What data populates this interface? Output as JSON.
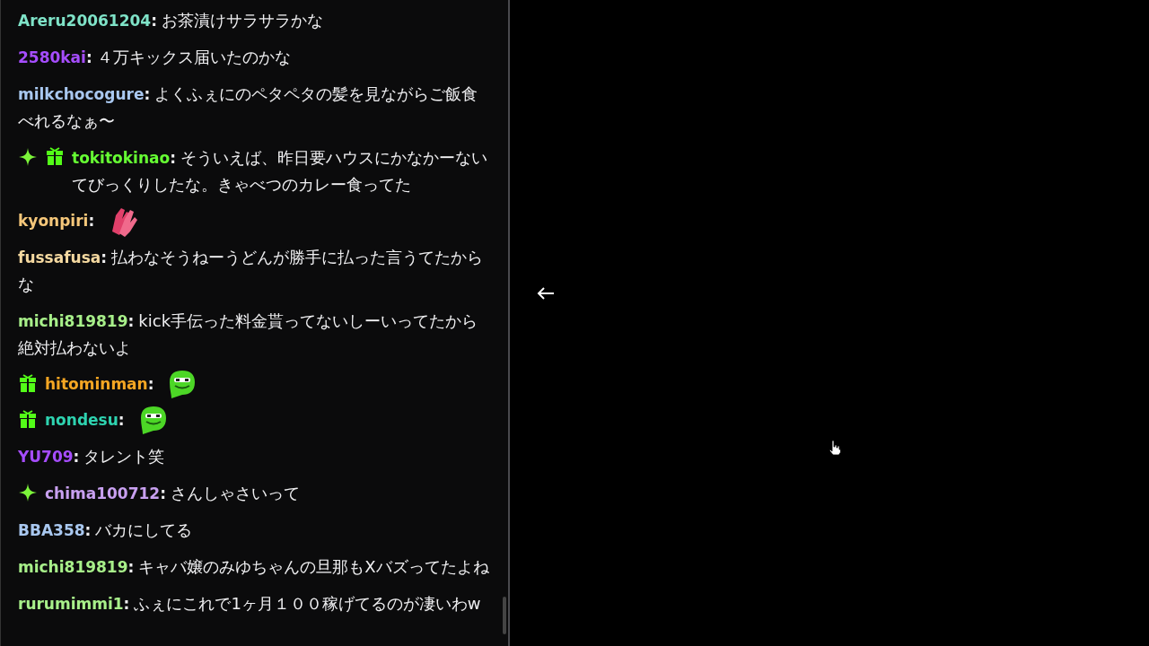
{
  "chat": {
    "messages": [
      {
        "user": "Areru20061204",
        "color": "#7fe3c8",
        "sep": ":",
        "text": "お茶漬けサラサラかな"
      },
      {
        "user": "2580kai",
        "color": "#a64dff",
        "sep": ":",
        "text": "４万キックス届いたのかな"
      },
      {
        "user": "milkchocogure",
        "color": "#a9c8f0",
        "sep": ":",
        "text": "よくふぇにのペタペタの髪を見ながらご飯食べれるなぁ〜"
      },
      {
        "badges": [
          {
            "kind": "sparkle"
          },
          {
            "kind": "gift"
          }
        ],
        "user": "tokitokinao",
        "color": "#66ff33",
        "sep": ":",
        "text": "そういえば、昨日要ハウスにかなかーないてびっくりしたな。きゃべつのカレー食ってた"
      },
      {
        "user": "kyonpiri",
        "color": "#f5c77a",
        "sep": ":",
        "emote": {
          "kind": "hands"
        }
      },
      {
        "user": "fussafusa",
        "color": "#f5d9a0",
        "sep": ":",
        "text": "払わなそうねーうどんが勝手に払った言うてたからな"
      },
      {
        "user": "michi819819",
        "color": "#a8f08a",
        "sep": ":",
        "text": "kick手伝った料金貰ってないしーいってたから絶対払わないよ"
      },
      {
        "badges": [
          {
            "kind": "gift"
          }
        ],
        "user": "hitominman",
        "color": "#f5a623",
        "sep": ":",
        "emote": {
          "kind": "frog"
        }
      },
      {
        "badges": [
          {
            "kind": "gift"
          }
        ],
        "user": "nondesu",
        "color": "#2ed3b0",
        "sep": ":",
        "emote": {
          "kind": "frog"
        }
      },
      {
        "user": "YU709",
        "color": "#a64dff",
        "sep": ":",
        "text": "タレント笑"
      },
      {
        "badges": [
          {
            "kind": "sparkle"
          }
        ],
        "user": "chima100712",
        "color": "#c8a0f0",
        "sep": ":",
        "text": "さんしゃさいって"
      },
      {
        "user": "BBA358",
        "color": "#a9c8f0",
        "sep": ":",
        "text": "バカにしてる"
      },
      {
        "user": "michi819819",
        "color": "#a8f08a",
        "sep": ":",
        "text": "キャバ嬢のみゆちゃんの旦那もXバズってたよね"
      },
      {
        "user": "rurumimmi1",
        "color": "#a8f08a",
        "sep": ":",
        "text": "ふぇにこれで1ヶ月１００稼げてるのが凄いわw"
      }
    ]
  }
}
